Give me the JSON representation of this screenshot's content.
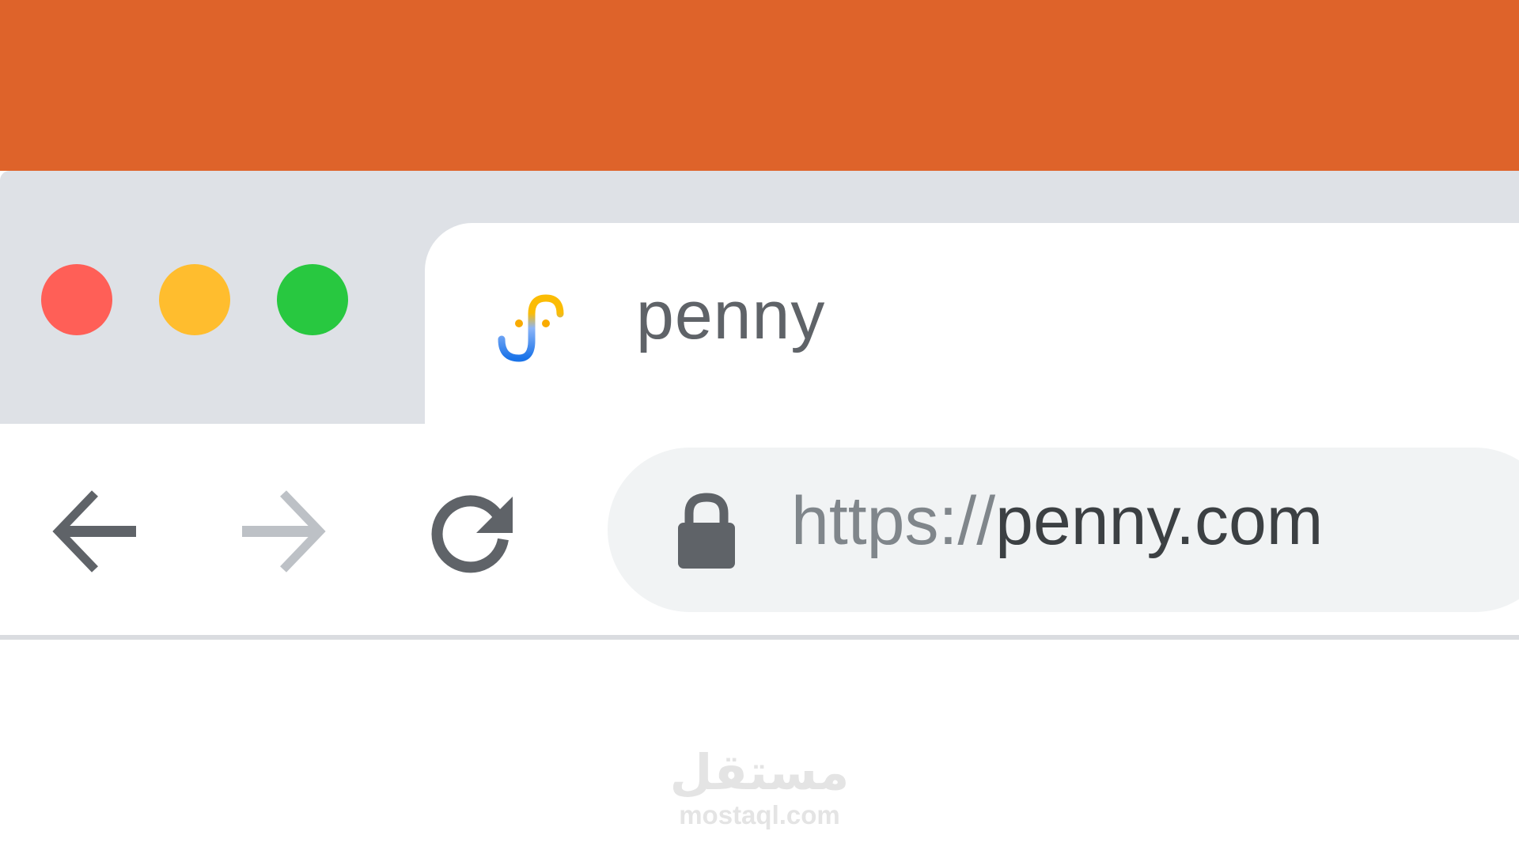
{
  "tab": {
    "title": "penny",
    "favicon": "penny-logo-icon"
  },
  "window_controls": {
    "close_color": "#FF5F57",
    "minimize_color": "#FFBD2E",
    "maximize_color": "#28C840"
  },
  "toolbar": {
    "back_icon": "arrow-left-icon",
    "forward_icon": "arrow-right-icon",
    "reload_icon": "reload-icon"
  },
  "omnibox": {
    "lock_icon": "lock-icon",
    "scheme": "https://",
    "host": "penny.com"
  },
  "watermark": {
    "logo_text": "مستقل",
    "site": "mostaql.com"
  },
  "colors": {
    "header_band": "#DE632A",
    "tab_strip": "#DEE1E6",
    "omnibox_bg": "#F1F3F4",
    "text_primary": "#3C4043",
    "text_secondary": "#80868B"
  }
}
